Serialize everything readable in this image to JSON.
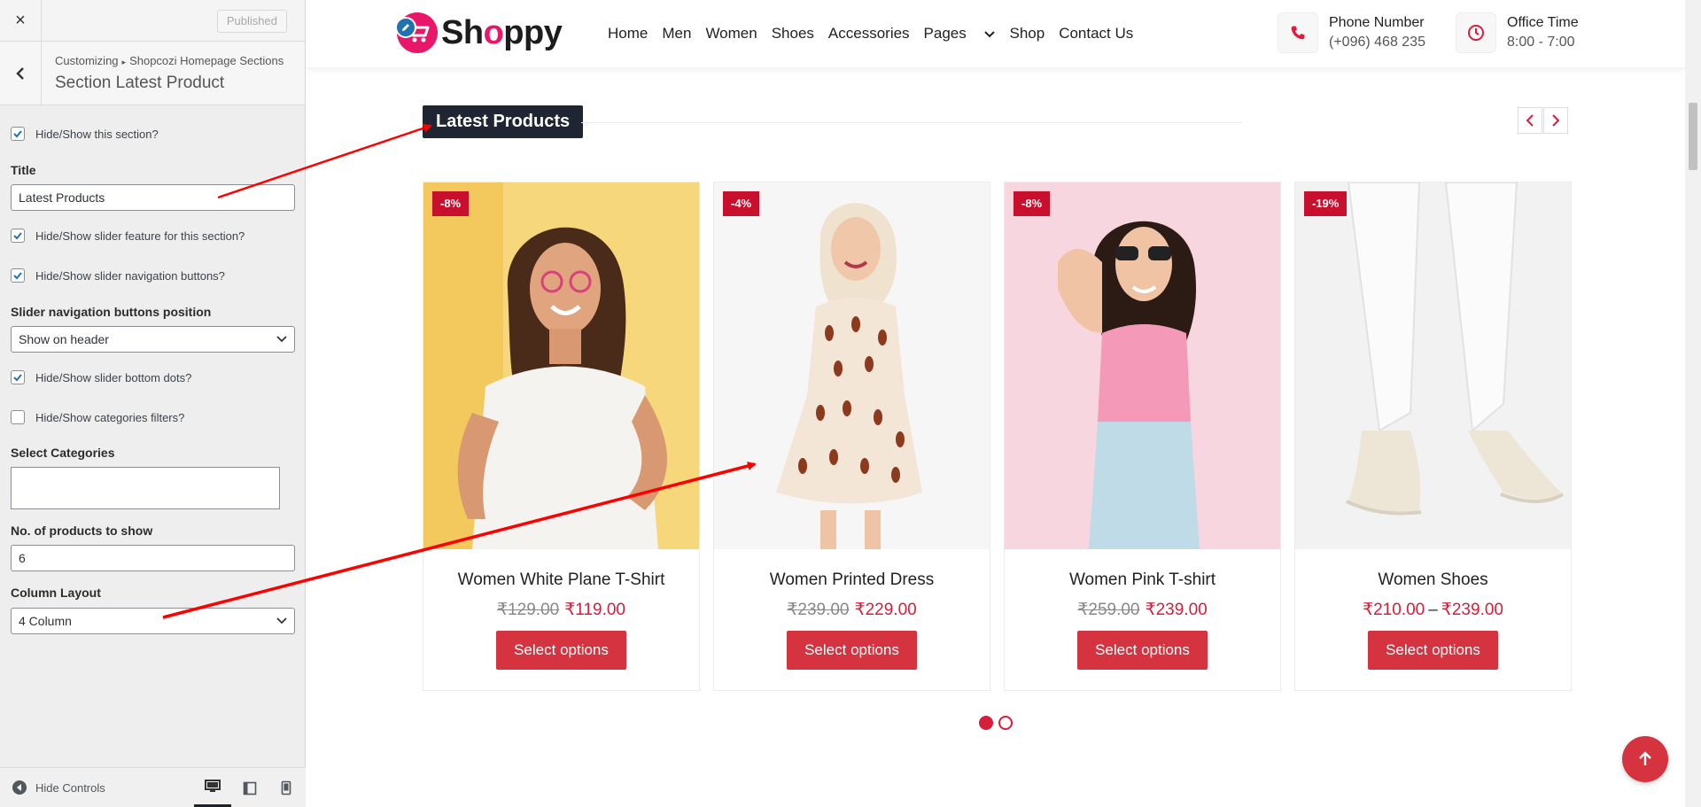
{
  "customizer": {
    "close_label": "×",
    "published_label": "Published",
    "breadcrumb_root": "Customizing",
    "breadcrumb_parent": "Shopcozi Homepage Sections",
    "section_title": "Section Latest Product",
    "options": {
      "hide_show_section": {
        "label": "Hide/Show this section?",
        "checked": true
      },
      "title_label": "Title",
      "title_value": "Latest Products",
      "slider_feature": {
        "label": "Hide/Show slider feature for this section?",
        "checked": true
      },
      "slider_nav": {
        "label": "Hide/Show slider navigation buttons?",
        "checked": true
      },
      "nav_position_label": "Slider navigation buttons position",
      "nav_position_value": "Show on header",
      "bottom_dots": {
        "label": "Hide/Show slider bottom dots?",
        "checked": true
      },
      "cat_filters": {
        "label": "Hide/Show categories filters?",
        "checked": false
      },
      "select_categories_label": "Select Categories",
      "products_count_label": "No. of products to show",
      "products_count_value": "6",
      "column_layout_label": "Column Layout",
      "column_layout_value": "4 Column"
    },
    "footer": {
      "hide_controls": "Hide Controls",
      "devices": [
        "desktop-icon",
        "tablet-icon",
        "mobile-icon"
      ],
      "active_device": "desktop"
    }
  },
  "site": {
    "logo_text_pre": "Sh",
    "logo_text_o": "o",
    "logo_text_post": "ppy",
    "brand_color": "#e8176a",
    "nav": [
      "Home",
      "Men",
      "Women",
      "Shoes",
      "Accessories",
      "Pages",
      "Shop",
      "Contact Us"
    ],
    "phone_label": "Phone Number",
    "phone_value": "(+096) 468 235",
    "office_label": "Office Time",
    "office_value": "8:00 - 7:00"
  },
  "section": {
    "title": "Latest Products",
    "accent_color": "#d71e3a",
    "products": [
      {
        "name": "Women White Plane T-Shirt",
        "badge": "-8%",
        "old_price": "₹129.00",
        "price": "₹119.00",
        "button": "Select options"
      },
      {
        "name": "Women Printed Dress",
        "badge": "-4%",
        "old_price": "₹239.00",
        "price": "₹229.00",
        "button": "Select options"
      },
      {
        "name": "Women Pink T-shirt",
        "badge": "-8%",
        "old_price": "₹259.00",
        "price": "₹239.00",
        "button": "Select options"
      },
      {
        "name": "Women Shoes",
        "badge": "-19%",
        "price_min": "₹210.00",
        "price_sep": "–",
        "price_max": "₹239.00",
        "button": "Select options"
      }
    ],
    "pagination": {
      "pages": 2,
      "current": 1
    }
  }
}
